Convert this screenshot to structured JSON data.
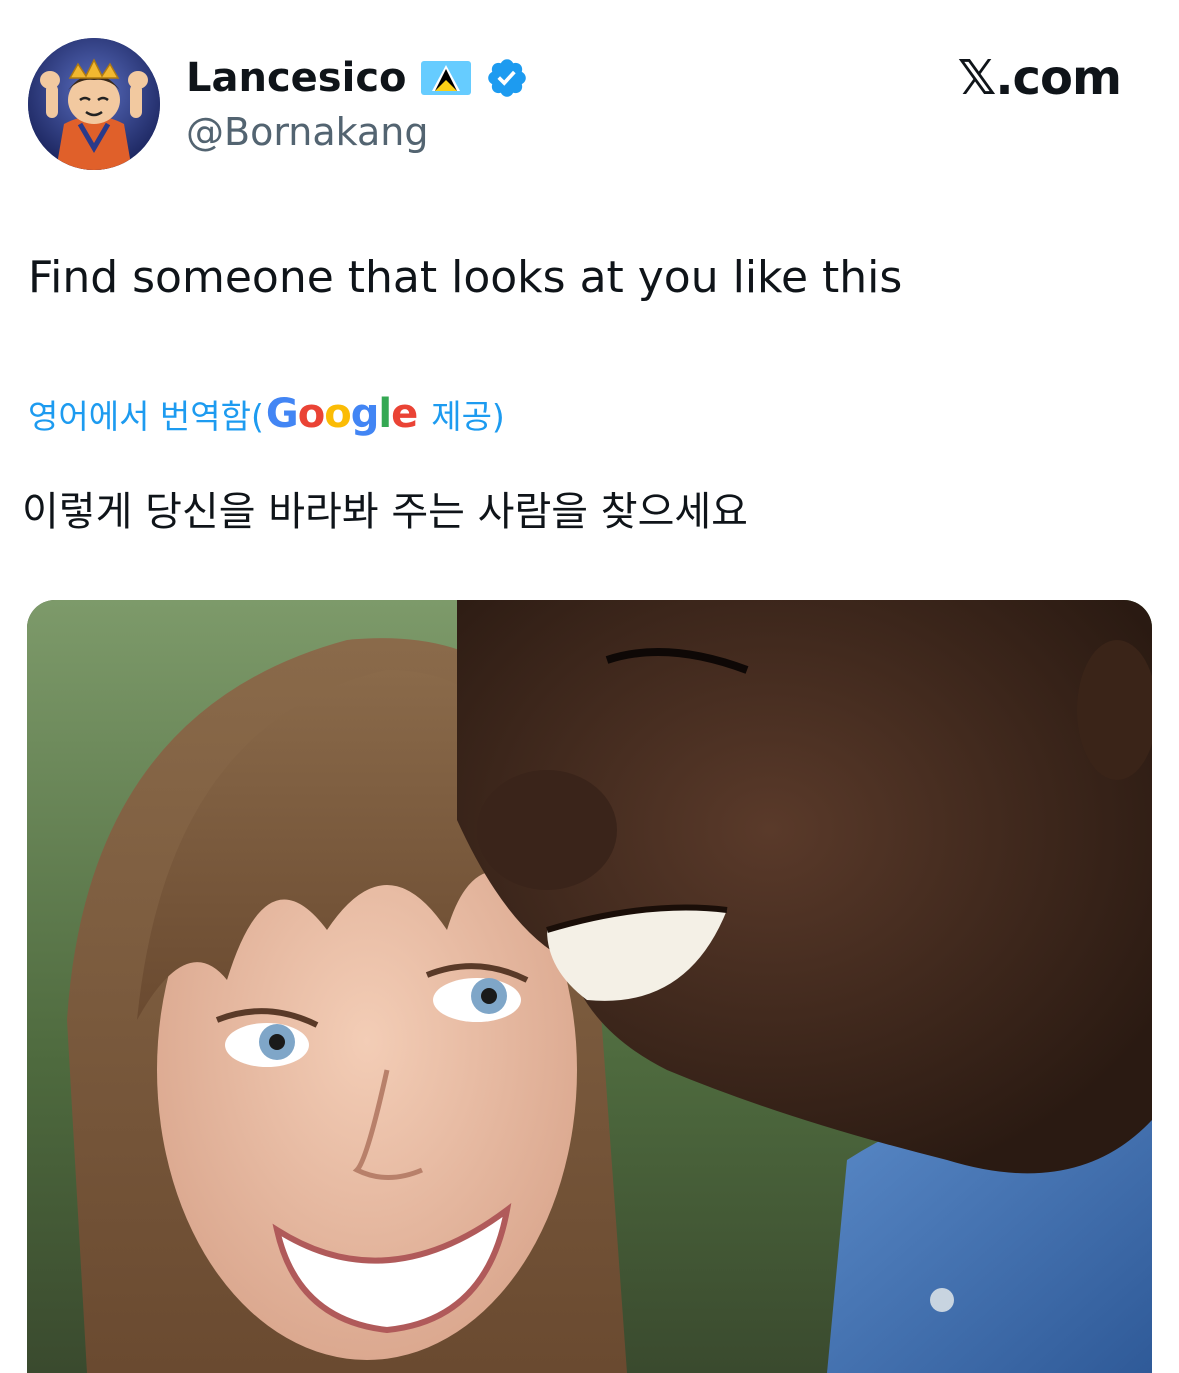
{
  "author": {
    "display_name": "Lancesico",
    "handle": "@Bornakang",
    "avatar_icon": "cartoon-avatar-icon",
    "flag_icon": "saint-lucia-flag-icon",
    "verified_icon": "verified-badge-icon",
    "verified_color": "#1d9bf0"
  },
  "site": {
    "label": "𝕏.com"
  },
  "tweet": {
    "text": "Find someone that looks at you like this",
    "translation": {
      "prefix": "영어에서 번역함(",
      "provider": [
        "G",
        "o",
        "o",
        "g",
        "l",
        "e"
      ],
      "suffix": "제공)",
      "text": "이렇게 당신을 바라봐 주는 사람을 찾으세요",
      "link_color": "#1d9bf0"
    },
    "media": {
      "type": "photo"
    }
  }
}
